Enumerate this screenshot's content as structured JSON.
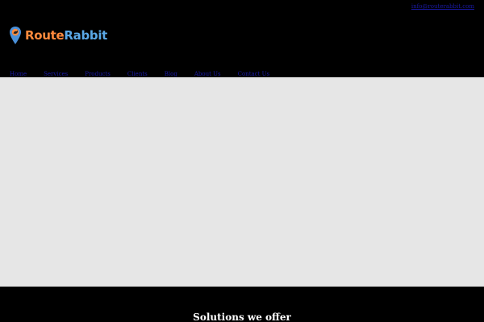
{
  "header": {
    "email": "info@routerabbit.com"
  },
  "logo": {
    "part1": "Route",
    "part2": "Rabbit",
    "pin_color": "#4a90d9",
    "accent_color": "#ff8a3d"
  },
  "nav": {
    "items": [
      "Home",
      "Services",
      "Products",
      "Clients",
      "Blog",
      "About Us",
      "Contact Us"
    ]
  },
  "section": {
    "title": "Solutions we offer"
  },
  "colors": {
    "header_bg": "#000000",
    "hero_bg": "#e6e6e6",
    "link": "#1a1aa6",
    "active_link": "#0000ee"
  }
}
